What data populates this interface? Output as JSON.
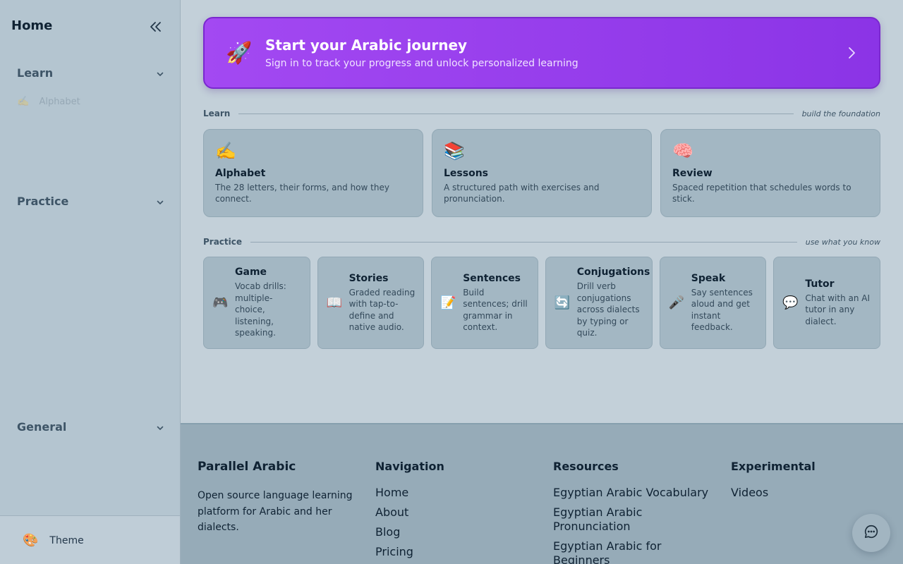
{
  "sidebar": {
    "home": "Home",
    "sections": [
      {
        "label": "Learn"
      },
      {
        "label": "Practice"
      },
      {
        "label": "General"
      }
    ],
    "learn_subitem": {
      "icon": "✍️",
      "label": "Alphabet"
    },
    "theme": {
      "icon": "🎨",
      "label": "Theme"
    }
  },
  "hero": {
    "icon": "🚀",
    "title": "Start your Arabic journey",
    "subtitle": "Sign in to track your progress and unlock personalized learning"
  },
  "learn": {
    "title": "Learn",
    "note": "build the foundation",
    "cards": [
      {
        "icon": "✍️",
        "title": "Alphabet",
        "desc": "The 28 letters, their forms, and how they connect."
      },
      {
        "icon": "📚",
        "title": "Lessons",
        "desc": "A structured path with exercises and pronunciation."
      },
      {
        "icon": "🧠",
        "title": "Review",
        "desc": "Spaced repetition that schedules words to stick."
      }
    ]
  },
  "practice": {
    "title": "Practice",
    "note": "use what you know",
    "cards": [
      {
        "icon": "🎮",
        "title": "Game",
        "desc": "Vocab drills: multiple-choice, listening, speaking."
      },
      {
        "icon": "📖",
        "title": "Stories",
        "desc": "Graded reading with tap-to-define and native audio."
      },
      {
        "icon": "📝",
        "title": "Sentences",
        "desc": "Build sentences; drill grammar in context."
      },
      {
        "icon": "🔄",
        "title": "Conjugations",
        "desc": "Drill verb conjugations across dialects by typing or quiz."
      },
      {
        "icon": "🎤",
        "title": "Speak",
        "desc": "Say sentences aloud and get instant feedback."
      },
      {
        "icon": "💬",
        "title": "Tutor",
        "desc": "Chat with an AI tutor in any dialect."
      }
    ]
  },
  "footer": {
    "brand": "Parallel Arabic",
    "desc": "Open source language learning platform for Arabic and her dialects.",
    "navigation": {
      "title": "Navigation",
      "links": [
        "Home",
        "About",
        "Blog",
        "Pricing"
      ]
    },
    "resources": {
      "title": "Resources",
      "links": [
        "Egyptian Arabic Vocabulary",
        "Egyptian Arabic Pronunciation",
        "Egyptian Arabic for Beginners"
      ]
    },
    "experimental": {
      "title": "Experimental",
      "links": [
        "Videos"
      ]
    }
  }
}
